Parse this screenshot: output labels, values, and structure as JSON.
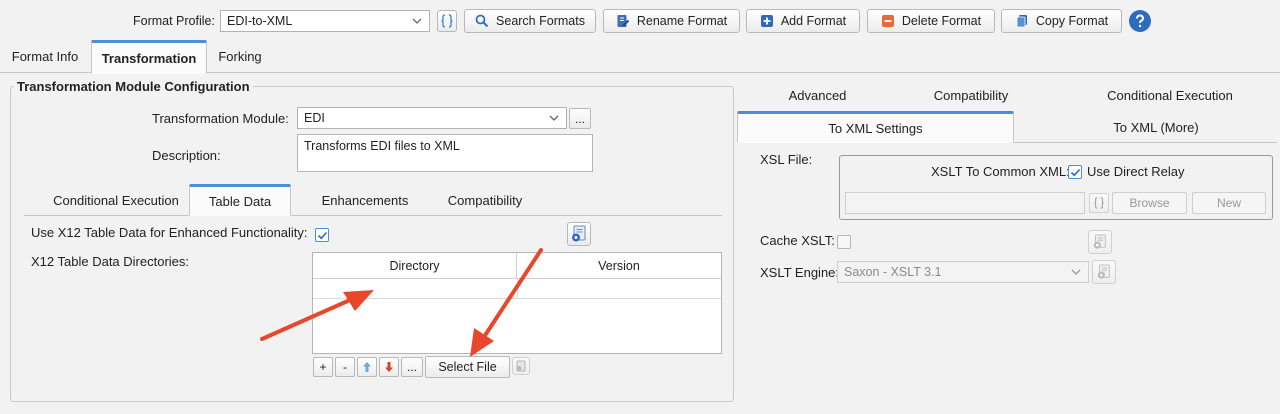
{
  "toolbar": {
    "profile_label": "Format Profile:",
    "profile_value": "EDI-to-XML",
    "search_label": "Search Formats",
    "rename_label": "Rename Format",
    "add_label": "Add Format",
    "delete_label": "Delete Format",
    "copy_label": "Copy Format",
    "help_icon": "question-circle-icon"
  },
  "main_tabs": [
    {
      "label": "Format Info",
      "active": false
    },
    {
      "label": "Transformation",
      "active": true
    },
    {
      "label": "Forking",
      "active": false
    }
  ],
  "module_config": {
    "title": "Transformation Module Configuration",
    "module_label": "Transformation Module:",
    "module_value": "EDI",
    "more_label": "...",
    "description_label": "Description:",
    "description_value": "Transforms EDI files to XML"
  },
  "sub_tabs": [
    {
      "label": "Conditional Execution",
      "active": false
    },
    {
      "label": "Table Data",
      "active": true
    },
    {
      "label": "Enhancements",
      "active": false
    },
    {
      "label": "Compatibility",
      "active": false
    }
  ],
  "table_data": {
    "use_x12_label": "Use X12 Table Data for Enhanced Functionality:",
    "use_x12_checked": true,
    "dirs_label": "X12 Table Data Directories:",
    "columns": [
      "Directory",
      "Version"
    ],
    "row_controls": {
      "add": "+",
      "remove": "-",
      "more": "...",
      "select_file": "Select File"
    }
  },
  "right_tabs_row1": [
    "Advanced",
    "Compatibility",
    "Conditional Execution"
  ],
  "right_tabs_row2": [
    {
      "label": "To XML Settings",
      "active": true
    },
    {
      "label": "To XML (More)",
      "active": false
    }
  ],
  "xml_settings": {
    "xsl_file_label": "XSL File:",
    "xslt_common_label": "XSLT To Common XML:",
    "direct_relay_label": "Use Direct Relay",
    "direct_relay_checked": true,
    "browse_label": "Browse",
    "new_label": "New",
    "cache_label": "Cache XSLT:",
    "cache_checked": false,
    "engine_label": "XSLT Engine:",
    "engine_value": "Saxon - XSLT 3.1"
  },
  "colors": {
    "accent": "#4d8fd6",
    "arrow": "#e8472b"
  }
}
